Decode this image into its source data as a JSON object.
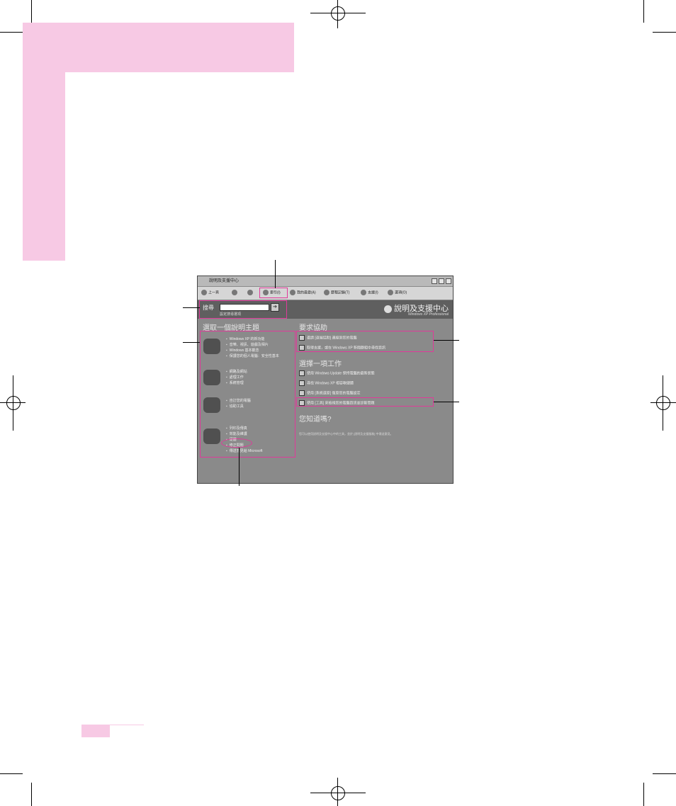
{
  "window": {
    "title": "說明及支援中心"
  },
  "toolbar": {
    "back": "上一頁",
    "index": "索引(I)",
    "favorites": "我的最愛(A)",
    "history": "歷程記錄(T)",
    "support": "支援(I)",
    "options": "選項(O)"
  },
  "search": {
    "label": "搜尋",
    "options_link": "設定搜尋選項"
  },
  "brand": {
    "title": "說明及支援中心",
    "subtitle": "Windows XP Professional"
  },
  "topics": {
    "heading": "選取一個說明主題",
    "groups": [
      {
        "items": [
          "Windows XP 的新功能",
          "音樂、視訊、遊戲及相片",
          "Windows 基本觀念",
          "保護您的個人電腦：安全性基本"
        ]
      },
      {
        "items": [
          "網路及網站",
          "處理工作",
          "系統管理"
        ]
      },
      {
        "items": [
          "自訂您的電腦",
          "協助工具"
        ]
      },
      {
        "items": [
          "列印及傳真",
          "效能及維護",
          "硬體",
          "修正問題",
          "傳送意見給 Microsoft"
        ]
      }
    ]
  },
  "assistance": {
    "heading": "要求協助",
    "items": [
      "邀請 [遠端協助] 連線到您的電腦",
      "取得支援，或在 Windows XP 新聞群組中尋找資訊"
    ]
  },
  "tasks": {
    "heading": "選擇一項工作",
    "items": [
      "使用 Windows Update 保持電腦的最新狀態",
      "尋找 Windows XP 相容軟硬體",
      "使用 [系統還原] 復原您的電腦設定",
      "使用 [工具] 來檢視您的電腦資訊並診斷問題"
    ]
  },
  "did_you_know": {
    "heading": "您知道嗎?",
    "text": "您可以使用說明及支援中心中的工具，並於 [說明及支援服務] 中傳送意見。"
  }
}
